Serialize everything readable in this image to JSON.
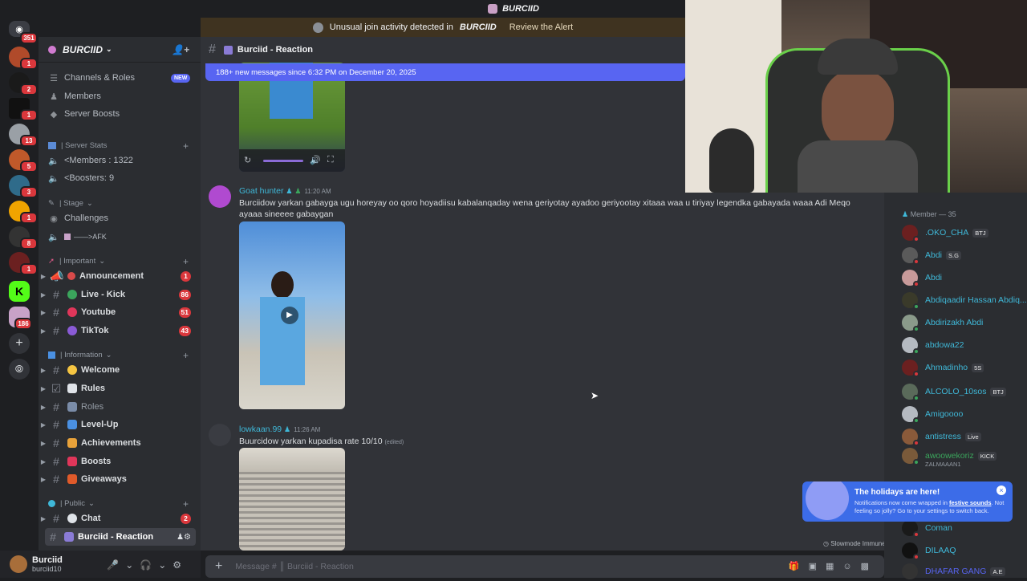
{
  "window_title": "BURCIID",
  "alert": {
    "text": "Unusual join activity detected in",
    "server": "BURCIID",
    "action": "Review the Alert"
  },
  "guild_badges": [
    "351",
    "1",
    "2",
    "1",
    "13",
    "5",
    "3",
    "1",
    "8",
    "1",
    "186"
  ],
  "server": {
    "name": "BURCIID"
  },
  "sidebar_top": [
    {
      "label": "Channels & Roles",
      "badge": "NEW"
    },
    {
      "label": "Members"
    },
    {
      "label": "Server Boosts"
    }
  ],
  "categories": {
    "stats": "| Server Stats",
    "stage": "| Stage",
    "important": "| Important",
    "information": "| Information",
    "public": "| Public"
  },
  "stats_items": [
    "<Members : 1322",
    "<Boosters: 9"
  ],
  "stage_items": [
    "Challenges",
    "——>AFK"
  ],
  "important_channels": [
    {
      "label": "Announcement",
      "count": "1"
    },
    {
      "label": "Live - Kick",
      "count": "86"
    },
    {
      "label": "Youtube",
      "count": "51"
    },
    {
      "label": "TikTok",
      "count": "43"
    }
  ],
  "information_channels": [
    {
      "label": "Welcome"
    },
    {
      "label": "Rules"
    },
    {
      "label": "Roles"
    },
    {
      "label": "Level-Up"
    },
    {
      "label": "Achievements"
    },
    {
      "label": "Boosts"
    },
    {
      "label": "Giveaways"
    }
  ],
  "public_channels": [
    {
      "label": "Chat",
      "count": "2"
    },
    {
      "label": "Burciid - Reaction"
    }
  ],
  "user": {
    "name": "Burciid",
    "tag": "burciid10"
  },
  "channel": {
    "name": "Burciid - Reaction"
  },
  "new_messages_bar": "188+ new messages since 6:32 PM on December 20, 2025",
  "messages": [
    {
      "author": "Goat hunter",
      "time": "11:20 AM",
      "text": "Burciidow yarkan gabayga ugu horeyay oo qoro hoyadiisu kabalanqaday wena geriyotay ayadoo geriyootay xitaaa waa u tiriyay legendka gabayada waaa Adi Meqo ayaaa sineeee gabaygan"
    },
    {
      "author": "lowkaan.99",
      "time": "11:26 AM",
      "text": "Buurcidow yarkan kupadisa rate 10/10",
      "edited": "(edited)"
    }
  ],
  "input_placeholder": "Message # ║ Burciid - Reaction",
  "slowmode": "Slowmode Immune",
  "members_header": "Member — 35",
  "members": [
    {
      "name": ".OKO_CHA",
      "tag": "BTJ"
    },
    {
      "name": "Abdi",
      "tag": "S.G"
    },
    {
      "name": "Abdi"
    },
    {
      "name": "Abdiqaadir Hassan Abdiq..."
    },
    {
      "name": "Abdirizakh Abdi"
    },
    {
      "name": "abdowa22"
    },
    {
      "name": "Ahmadinho",
      "tag": "5S"
    },
    {
      "name": "ALCOLO_10sos",
      "tag": "BTJ"
    },
    {
      "name": "Amigoooo"
    },
    {
      "name": "antistress",
      "tag": "Live"
    },
    {
      "name": "awoowekoriz",
      "tag": "KICK",
      "sub": "ZALMAAAN1"
    },
    {
      "name": "Coman"
    },
    {
      "name": "DILAAQ"
    },
    {
      "name": "DHAFAR GANG",
      "tag": "A.E"
    }
  ],
  "toast": {
    "title": "The holidays are here!",
    "body_pre": "Notifications now come wrapped in",
    "body_link": "festive sounds",
    "body_post": ". Not feeling so jolly? Go to your settings to switch back."
  },
  "colors": {
    "accent": "#5865f2",
    "danger": "#da373c",
    "link": "#3fb8d8",
    "bg": "#313338",
    "sidebar": "#2b2d31"
  }
}
